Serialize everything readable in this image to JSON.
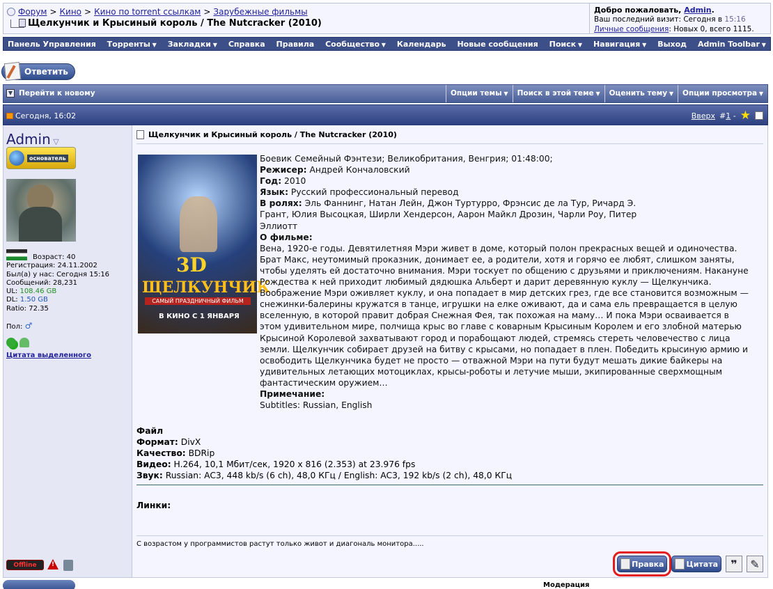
{
  "breadcrumb": {
    "items": [
      "Форум",
      "Кино",
      "Кино по torrent ссылкам",
      "Зарубежные фильмы"
    ],
    "sep": ">"
  },
  "thread_title": "Щелкунчик и Крысиный король / The Nutcracker (2010)",
  "welcome": {
    "greet": "Добро пожаловать,",
    "user": "Admin",
    "last_visit_label": "Ваш последний визит: Сегодня в",
    "last_visit_time": "15:16",
    "pm_link": "Личные сообщения",
    "pm_text": ": Новых 0, всего 1115."
  },
  "nav": [
    {
      "label": "Панель Управления",
      "dd": false
    },
    {
      "label": "Торренты",
      "dd": true
    },
    {
      "label": "Закладки",
      "dd": true
    },
    {
      "label": "Справка",
      "dd": false
    },
    {
      "label": "Правила",
      "dd": false
    },
    {
      "label": "Сообщество",
      "dd": true
    },
    {
      "label": "Календарь",
      "dd": false
    },
    {
      "label": "Новые сообщения",
      "dd": false
    },
    {
      "label": "Поиск",
      "dd": true
    },
    {
      "label": "Навигация",
      "dd": true
    },
    {
      "label": "Выход",
      "dd": false
    },
    {
      "label": "Admin Toolbar",
      "dd": true
    }
  ],
  "reply_button": "Ответить",
  "thread_tools": {
    "first_unread": "Перейти к новому",
    "tools": [
      "Опции темы",
      "Поиск в этой теме",
      "Оценить тему",
      "Опции просмотра"
    ]
  },
  "post_header": {
    "date": "Сегодня, 16:02",
    "top": "Вверх",
    "num_prefix": "#",
    "num": "1",
    "dash": "-"
  },
  "user": {
    "name": "Admin",
    "rank": "основатель",
    "age": "Возраст: 40",
    "reg": "Регистрация: 24.11.2002",
    "last_label": "Был(а) у нас: Сегодня 15:16",
    "posts": "Сообщений: 28,231",
    "ul_label": "UL:",
    "ul_val": "108.46 GB",
    "dl_label": "DL:",
    "dl_val": "1.50 GB",
    "ratio": "Ratio: 72.35",
    "sex_label": "Пол:",
    "sex_icon": "♂",
    "quote_selected": "Цитата выделенного",
    "offline": "Offline"
  },
  "post": {
    "title": "Щелкунчик и Крысиный король / The Nutcracker (2010)",
    "poster": {
      "t3": "3D",
      "title": "ЩЕЛКУНЧИК",
      "sub": "САМЫЙ ПРАЗДНИЧНЫЙ ФИЛЬМ",
      "date": "В КИНО С 1 ЯНВАРЯ"
    },
    "genre": "Боевик Семейный Фэнтези; Великобритания, Венгрия; 01:48:00;",
    "director_label": "Режисер:",
    "director": " Андрей Кончаловский",
    "year_label": "Год:",
    "year": " 2010",
    "lang_label": "Язык:",
    "lang": " Русский профессиональный перевод",
    "cast_label": "В ролях:",
    "cast": " Эль Фаннинг, Натан Лейн, Джон Туртурро, Фрэнсис де ла Тур, Ричард Э. Грант, Юлия Высоцкая, Ширли Хендерсон, Аарон Майкл Дрозин, Чарли Роу, Питер Эллиотт",
    "about_label": "О фильме:",
    "about": "Вена, 1920-е годы. Девятилетняя Мэри живет в доме, который полон прекрасных вещей и одиночества. Брат Макс, неутомимый проказник, донимает ее, а родители, хотя и горячо ее любят, слишком заняты, чтобы уделять ей достаточно внимания. Мэри тоскует по общению с друзьями и приключениям. Накануне Рождества к ней приходит любимый дядюшка Альберт и дарит деревянную куклу — Щелкунчика. Воображение Мэри оживляет куклу, и она попадает в мир детских грез, где все становится возможным — снежинки-балерины кружатся в танце, игрушки на елке оживают, да и сама ель превращается в целую вселенную, в которой правит добрая Снежная Фея, так похожая на маму… И пока Мэри осваивается в этом удивительном мире, полчища крыс во главе с коварным Крысиным Королем и его злобной матерью Крысиной Королевой захватывают город и порабощают людей, стремясь стереть человечество с лица земли. Щелкунчик собирает друзей на битву с крысами, но попадает в плен. Победить крысиную армию и освободить Щелкунчика будет не просто — отважной Мэри на пути будут мешать дикие байкеры на удивительных летающих мотоциклах, крысы-роботы и летучие мыши, экипированные сверхмощным фантастическим оружием…",
    "note_label": "Примечание:",
    "note": "Subtitles: Russian, English",
    "file_label": "Файл",
    "format_label": "Формат:",
    "format": " DivX",
    "quality_label": "Качество:",
    "quality": " BDRip",
    "video_label": "Видео:",
    "video": " H.264, 10,1 Мбит/сек, 1920 x 816 (2.353) at 23.976 fps",
    "audio_label": "Звук:",
    "audio": " Russian: AC3, 448 kb/s (6 ch), 48,0 КГц / English: AC3, 192 kb/s (2 ch), 48,0 КГц",
    "links_label": "Линки:",
    "signature": "С возрастом у программистов растут только живот и диагональ монитора.....",
    "edit_btn": "Правка",
    "quote_btn": "Цитата",
    "multiquote": "❞"
  },
  "footer": {
    "moderation": "Модерация"
  },
  "colors": {
    "nav": "#3d4f88",
    "highlight": "#e41b1b"
  }
}
